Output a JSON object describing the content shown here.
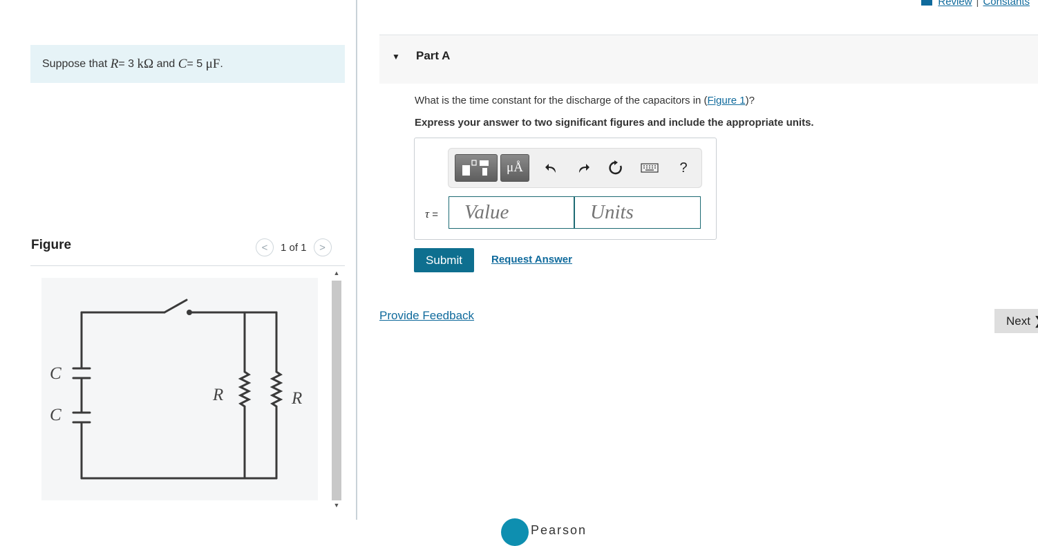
{
  "topnav": {
    "review": "Review",
    "separator": "|",
    "constants": "Constants"
  },
  "problem": {
    "prefix": "Suppose that ",
    "r_sym": "R",
    "r_eq": " = 3 ",
    "r_unit": "kΩ",
    "mid": " and ",
    "c_sym": "C",
    "c_eq": " = 5 ",
    "c_unit": "μF",
    "suffix": "."
  },
  "figure": {
    "title": "Figure",
    "prev": "<",
    "next": ">",
    "count": "1 of 1",
    "labels": {
      "c_top": "C",
      "c_bottom": "C",
      "r_left": "R",
      "r_right": "R"
    }
  },
  "part": {
    "label": "Part A"
  },
  "question": {
    "text_before": "What is the time constant for the discharge of the capacitors in (",
    "link": "Figure 1",
    "text_after": ")?",
    "instruction": "Express your answer to two significant figures and include the appropriate units."
  },
  "toolbar": {
    "units_label": "μÅ",
    "help": "?"
  },
  "answer": {
    "symbol": "τ",
    "equals": " =",
    "value_placeholder": "Value",
    "units_placeholder": "Units"
  },
  "actions": {
    "submit": "Submit",
    "request_answer": "Request Answer",
    "feedback": "Provide Feedback",
    "next": "Next ❯"
  },
  "footer": {
    "brand": "Pearson"
  }
}
